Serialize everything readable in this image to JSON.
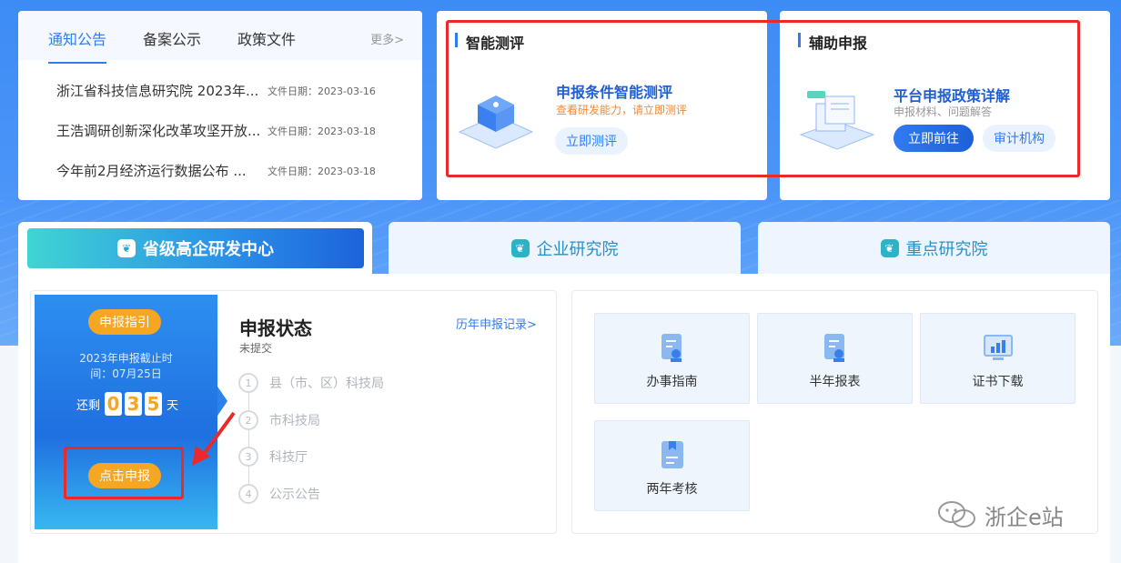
{
  "notice": {
    "tabs": [
      "通知公告",
      "备案公示",
      "政策文件"
    ],
    "more": "更多>",
    "items": [
      {
        "title": "浙江省科技信息研究院 2023年...",
        "date_label": "文件日期：2023-03-16"
      },
      {
        "title": "王浩调研创新深化改革攻坚开放...",
        "date_label": "文件日期：2023-03-18"
      },
      {
        "title": "今年前2月经济运行数据公布 ...",
        "date_label": "文件日期：2023-03-18"
      }
    ]
  },
  "smart_eval": {
    "section_title": "智能测评",
    "headline": "申报条件智能测评",
    "subtext": "查看研发能力，请立即测评",
    "button": "立即测评"
  },
  "assist": {
    "section_title": "辅助申报",
    "headline": "平台申报政策详解",
    "subtext": "申报材料、问题解答",
    "primary_button": "立即前往",
    "secondary_button": "审计机构"
  },
  "center_tabs": [
    "省级高企研发中心",
    "企业研究院",
    "重点研究院"
  ],
  "apply_panel": {
    "guide_badge": "申报指引",
    "deadline_line1": "2023年申报截止时",
    "deadline_line2": "间：07月25日",
    "remaining_prefix": "还剩",
    "digits": [
      "0",
      "3",
      "5"
    ],
    "remaining_suffix": "天",
    "apply_button": "点击申报"
  },
  "status": {
    "title": "申报状态",
    "subtitle": "未提交",
    "history_link": "历年申报记录>",
    "steps": [
      {
        "num": "1",
        "label": "县（市、区）科技局"
      },
      {
        "num": "2",
        "label": "市科技局"
      },
      {
        "num": "3",
        "label": "科技厅"
      },
      {
        "num": "4",
        "label": "公示公告"
      }
    ]
  },
  "services": [
    {
      "label": "办事指南",
      "icon": "document-stamp-icon"
    },
    {
      "label": "半年报表",
      "icon": "document-stamp-icon"
    },
    {
      "label": "证书下载",
      "icon": "monitor-chart-icon"
    },
    {
      "label": "两年考核",
      "icon": "bookmark-document-icon"
    }
  ],
  "watermark": "浙企e站",
  "colors": {
    "accent": "#2f7cf0",
    "orange": "#f5a623",
    "highlight_red": "#ec2929"
  }
}
